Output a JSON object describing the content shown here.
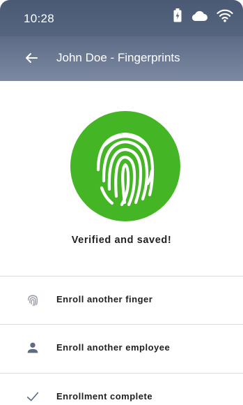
{
  "status_bar": {
    "time": "10:28"
  },
  "app_bar": {
    "title": "John Doe - Fingerprints"
  },
  "main": {
    "message": "Verified and saved!",
    "badge_color": "#44b524",
    "options": [
      {
        "label": "Enroll another finger",
        "icon": "fingerprint-icon"
      },
      {
        "label": "Enroll another employee",
        "icon": "person-icon"
      },
      {
        "label": "Enrollment complete",
        "icon": "checkmark-icon"
      }
    ]
  }
}
